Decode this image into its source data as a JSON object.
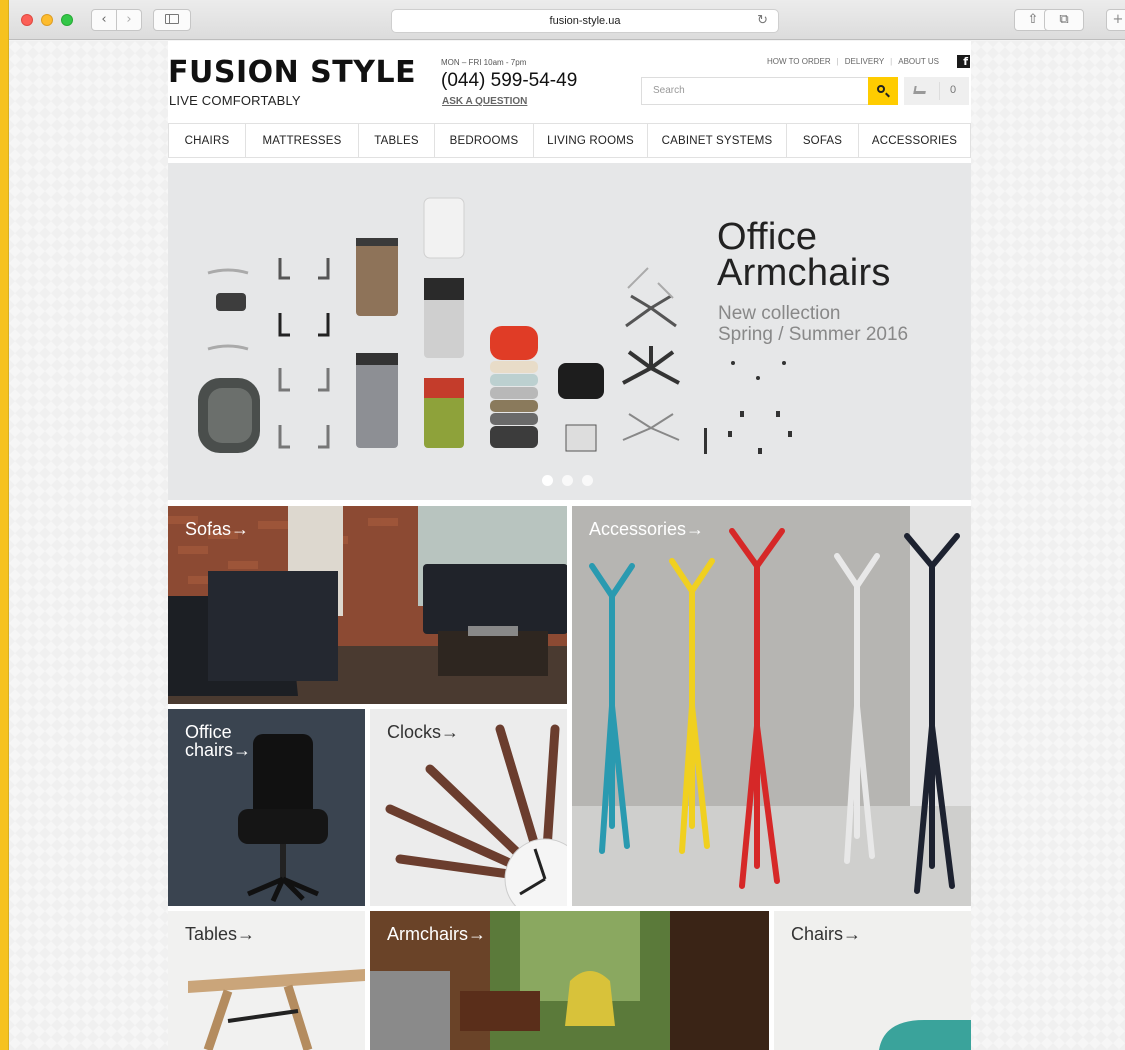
{
  "browser": {
    "url": "fusion-style.ua",
    "back_glyph": "‹",
    "forward_glyph": "›",
    "reload_glyph": "↻",
    "share_glyph": "⇧",
    "tabs_glyph": "⧉",
    "plus_glyph": "+"
  },
  "header": {
    "logo": "FUSION STYLE",
    "tagline": "LIVE COMFORTABLY",
    "hours": "MON – FRI 10am - 7pm",
    "phone": "(044) 599-54-49",
    "ask_question": "ASK A QUESTION",
    "links": [
      "HOW TO ORDER",
      "DELIVERY",
      "ABOUT US"
    ],
    "facebook_glyph": "f",
    "search_placeholder": "Search",
    "cart_count": "0"
  },
  "menu": [
    "CHAIRS",
    "MATTRESSES",
    "TABLES",
    "BEDROOMS",
    "LIVING ROOMS",
    "CABINET SYSTEMS",
    "SOFAS",
    "ACCESSORIES"
  ],
  "hero": {
    "title_line1": "Office",
    "title_line2": "Armchairs",
    "subtitle_line1": "New collection",
    "subtitle_line2": "Spring / Summer 2016",
    "slides": 3,
    "active_slide": 1
  },
  "tiles": {
    "sofas": "Sofas→",
    "accessories": "Accessories→",
    "office_chairs_1": "Office",
    "office_chairs_2": "chairs→",
    "clocks": "Clocks→",
    "tables": "Tables→",
    "armchairs": "Armchairs→",
    "chairs": "Chairs→"
  },
  "colors": {
    "accent": "#ffcc00",
    "frame": "#f6c21f"
  }
}
